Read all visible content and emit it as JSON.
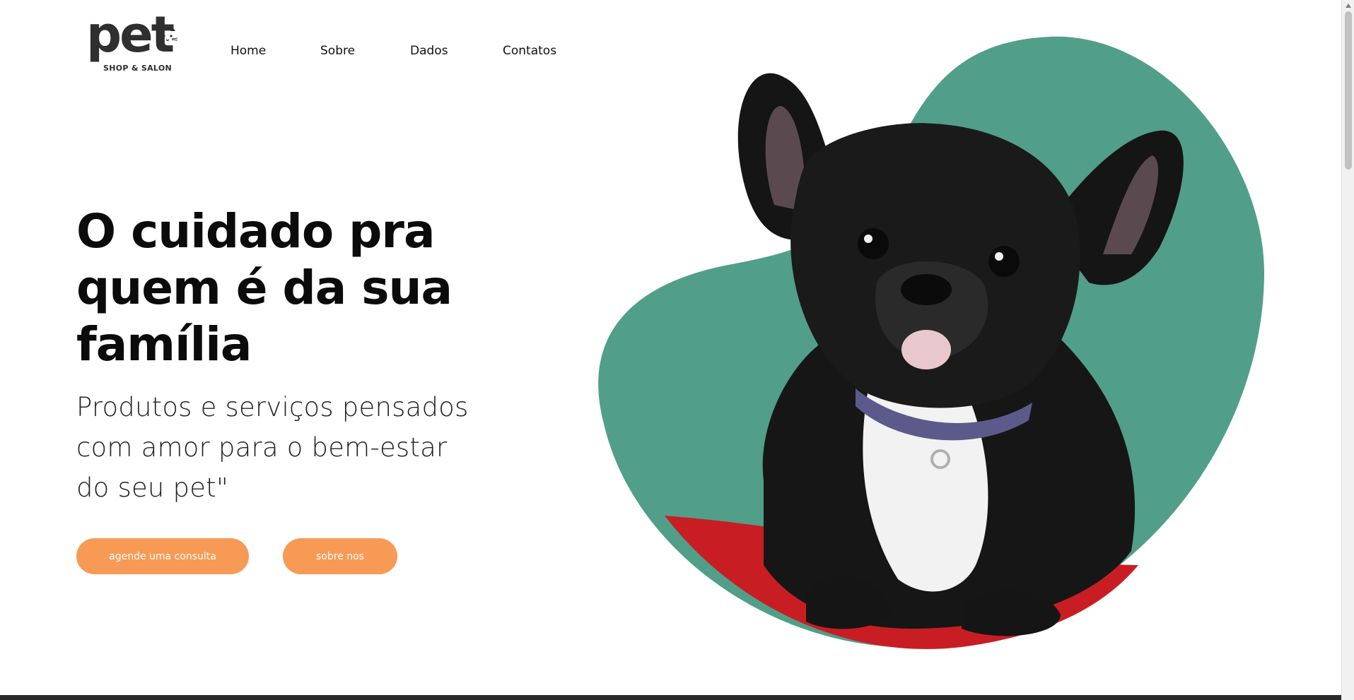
{
  "logo": {
    "word": "pet",
    "tagline": "SHOP & SALON"
  },
  "nav": {
    "items": [
      {
        "label": "Home"
      },
      {
        "label": "Sobre"
      },
      {
        "label": "Dados"
      },
      {
        "label": "Contatos"
      }
    ]
  },
  "hero": {
    "headline_lines": [
      "O cuidado pra",
      "quem é da sua",
      "família"
    ],
    "subhead_lines": [
      "Produtos e serviços pensados",
      "com amor para o bem-estar",
      "do seu pet\""
    ],
    "primary_button": "agende uma consulta",
    "secondary_button": "sobre nos",
    "image_description_icon": "french-bulldog-photo"
  },
  "colors": {
    "accent_button": "#f79a56",
    "blob_green": "#519e89",
    "text_dark": "#0b0b0b"
  }
}
